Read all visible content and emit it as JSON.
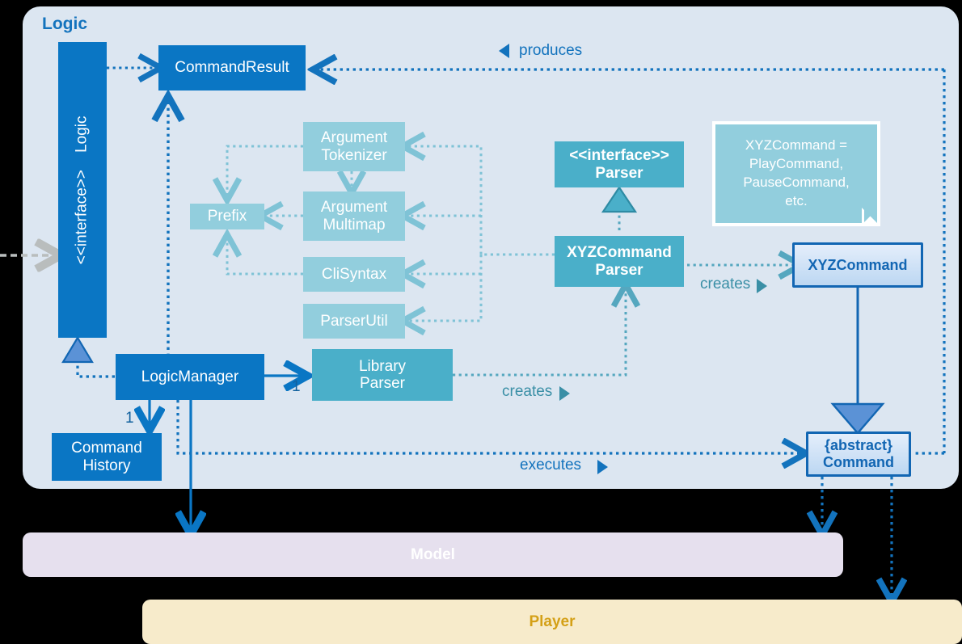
{
  "diagram": {
    "title": "Logic",
    "colors": {
      "panel_bg": "#dce6f1",
      "blue": "#0a76c4",
      "teal": "#4aafc9",
      "light_teal": "#92cedd",
      "accent_border": "#1266b3",
      "model_bar": "#e6e0ee",
      "player_bar": "#f7ebcb",
      "player_text": "#d4a017"
    }
  },
  "nodes": {
    "logic_interface": {
      "stereotype": "<<interface>>",
      "name": "Logic"
    },
    "command_result": {
      "name": "CommandResult"
    },
    "argument_tokenizer": {
      "line1": "Argument",
      "line2": "Tokenizer"
    },
    "argument_multimap": {
      "line1": "Argument",
      "line2": "Multimap"
    },
    "prefix": {
      "name": "Prefix"
    },
    "cli_syntax": {
      "name": "CliSyntax"
    },
    "parser_util": {
      "name": "ParserUtil"
    },
    "parser_interface": {
      "stereotype": "<<interface>>",
      "name": "Parser"
    },
    "xyz_command_parser": {
      "line1": "XYZCommand",
      "line2": "Parser"
    },
    "xyz_command": {
      "name": "XYZCommand"
    },
    "logic_manager": {
      "name": "LogicManager"
    },
    "library_parser": {
      "line1": "Library",
      "line2": "Parser"
    },
    "command_history": {
      "line1": "Command",
      "line2": "History"
    },
    "abstract_command": {
      "line1": "{abstract}",
      "line2": "Command"
    }
  },
  "note": {
    "line1": "XYZCommand =",
    "line2": "PlayCommand,",
    "line3": "PauseCommand,",
    "line4": "etc."
  },
  "bars": {
    "model": "Model",
    "player": "Player"
  },
  "edge_labels": {
    "produces": "produces",
    "creates_parser": "creates",
    "creates_library": "creates",
    "executes": "executes"
  },
  "multiplicities": {
    "logic_manager_to_library_parser": "1",
    "logic_manager_to_command_history": "1"
  }
}
